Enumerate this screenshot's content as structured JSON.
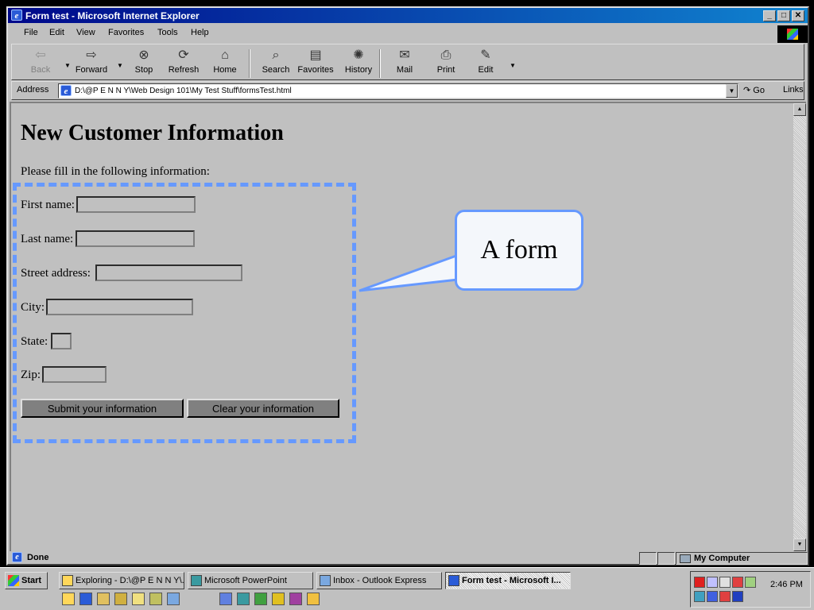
{
  "window": {
    "title": "Form test - Microsoft Internet Explorer"
  },
  "menu": [
    "File",
    "Edit",
    "View",
    "Favorites",
    "Tools",
    "Help"
  ],
  "toolbar": {
    "back": "Back",
    "forward": "Forward",
    "stop": "Stop",
    "refresh": "Refresh",
    "home": "Home",
    "search": "Search",
    "favorites": "Favorites",
    "history": "History",
    "mail": "Mail",
    "print": "Print",
    "edit": "Edit"
  },
  "address": {
    "label": "Address",
    "value": "D:\\@P E N N Y\\Web Design 101\\My Test Stuff\\formsTest.html",
    "go": "Go",
    "links": "Links"
  },
  "page": {
    "title": "New Customer Information",
    "instructions": "Please fill in the following information:",
    "fields": {
      "first_name": "First name:",
      "last_name": "Last name:",
      "street": "Street address:",
      "city": "City:",
      "state": "State:",
      "zip": "Zip:"
    },
    "submit": "Submit your information",
    "clear": "Clear your information"
  },
  "callout": {
    "text": "A form"
  },
  "status": {
    "text": "Done",
    "zone": "My Computer"
  },
  "taskbar": {
    "start": "Start",
    "tasks": [
      "Exploring - D:\\@P E N N Y\\...",
      "Microsoft PowerPoint",
      "Inbox - Outlook Express",
      "Form test - Microsoft I..."
    ],
    "clock": "2:46 PM"
  },
  "colors": {
    "highlight": "#6699ff",
    "titlebar": "#00088a"
  }
}
